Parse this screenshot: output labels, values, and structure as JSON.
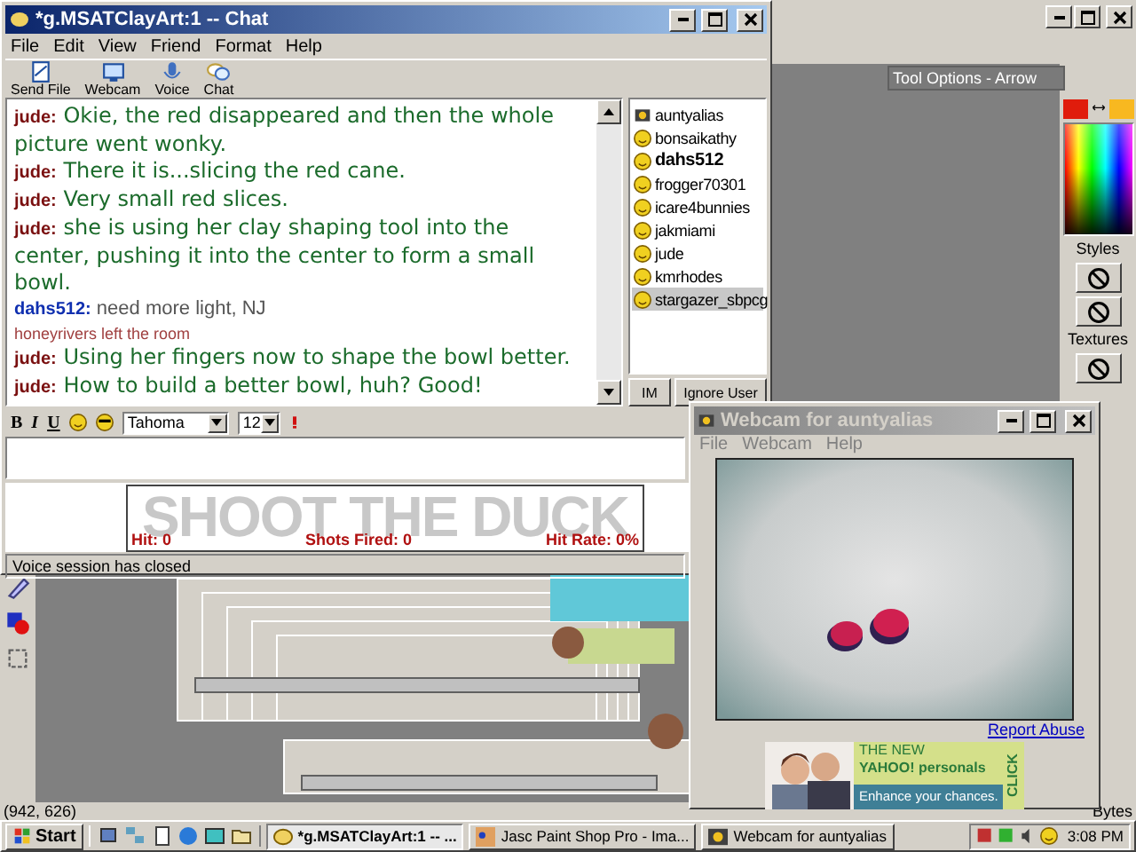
{
  "chat_window": {
    "title": "*g.MSATClayArt:1 -- Chat",
    "menu": [
      "File",
      "Edit",
      "View",
      "Friend",
      "Format",
      "Help"
    ],
    "toolbar": [
      {
        "kind": "file",
        "label": "Send File"
      },
      {
        "kind": "webcam",
        "label": "Webcam"
      },
      {
        "kind": "voice",
        "label": "Voice"
      },
      {
        "kind": "chat",
        "label": "Chat"
      }
    ],
    "messages": [
      {
        "kind": "fancy",
        "sender": "jude:",
        "text": "Okie, the red disappeared and then the whole picture went wonky."
      },
      {
        "kind": "fancy",
        "sender": "jude:",
        "text": "There it is...slicing the red cane."
      },
      {
        "kind": "fancy",
        "sender": "jude:",
        "text": "Very small red slices."
      },
      {
        "kind": "fancy",
        "sender": "jude:",
        "text": "she is using her clay shaping tool into the center, pushing it into the center to form a small bowl."
      },
      {
        "kind": "plain",
        "sender": "dahs512:",
        "text": "need more light, NJ"
      },
      {
        "kind": "notice",
        "text": "honeyrivers left the room"
      },
      {
        "kind": "fancy",
        "sender": "jude:",
        "text": "Using her fingers now to shape the bowl better."
      },
      {
        "kind": "fancy",
        "sender": "jude:",
        "text": "How to build a better bowl, huh? Good!"
      }
    ],
    "users": [
      {
        "name": "auntyalias",
        "kind": "webcam",
        "bold": false,
        "selected": false
      },
      {
        "name": "bonsaikathy",
        "kind": "smiley",
        "bold": false,
        "selected": false
      },
      {
        "name": "dahs512",
        "kind": "smiley",
        "bold": true,
        "selected": false
      },
      {
        "name": "frogger70301",
        "kind": "smiley",
        "bold": false,
        "selected": false
      },
      {
        "name": "icare4bunnies",
        "kind": "smiley",
        "bold": false,
        "selected": false
      },
      {
        "name": "jakmiami",
        "kind": "smiley",
        "bold": false,
        "selected": false
      },
      {
        "name": "jude",
        "kind": "smiley",
        "bold": false,
        "selected": false
      },
      {
        "name": "kmrhodes",
        "kind": "smiley",
        "bold": false,
        "selected": false
      },
      {
        "name": "stargazer_sbpcg",
        "kind": "smiley",
        "bold": false,
        "selected": true
      }
    ],
    "user_buttons": [
      "IM",
      "Ignore User"
    ],
    "format_bar": {
      "bold": "B",
      "italic": "I",
      "underline": "U",
      "font": "Tahoma",
      "size": "12"
    },
    "game": {
      "title": "SHOOT THE DUCK",
      "hit": "Hit: 0",
      "shots": "Shots Fired: 0",
      "rate": "Hit Rate: 0%"
    },
    "status": "Voice session has closed"
  },
  "paint_shop": {
    "tool_options": "Tool Options - Arrow",
    "swatches": [
      {
        "color": "#e01c0c"
      },
      {
        "color": "#f8b820"
      }
    ],
    "styles_label": "Styles",
    "textures_label": "Textures",
    "coords": "(942, 626)",
    "bytes": "Bytes"
  },
  "webcam_window": {
    "title": "Webcam for auntyalias",
    "menu": [
      "File",
      "Webcam",
      "Help"
    ],
    "report": "Report Abuse",
    "ad": {
      "headline": "THE NEW",
      "brand": "YAHOO! personals",
      "tagline": "Enhance your chances.",
      "click": "CLICK"
    }
  },
  "taskbar": {
    "start": "Start",
    "tasks": [
      {
        "label": "*g.MSATClayArt:1 -- ...",
        "kind": "chat",
        "selected": true
      },
      {
        "label": "Jasc Paint Shop Pro - Ima...",
        "kind": "paint",
        "selected": false
      },
      {
        "label": "Webcam for auntyalias",
        "kind": "webcam",
        "selected": false
      }
    ],
    "clock": "3:08 PM"
  }
}
